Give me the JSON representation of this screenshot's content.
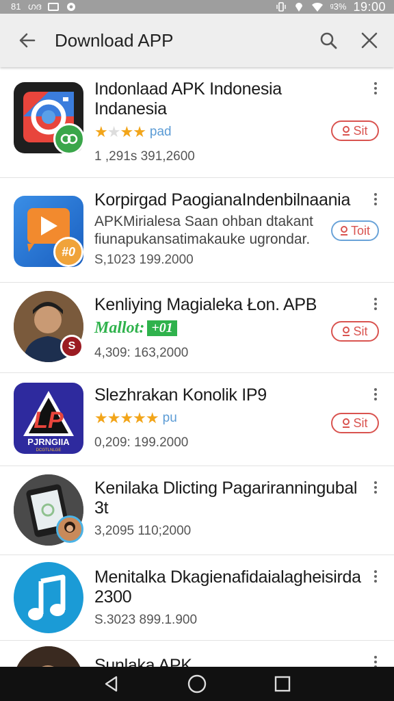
{
  "status_bar": {
    "left_text_1": "81",
    "left_text_2": "ഗദ",
    "battery_text": "ᵍ3%",
    "time": "19:00"
  },
  "appbar": {
    "title": "Download APP",
    "icons": [
      "back-arrow-icon",
      "search-icon",
      "close-icon"
    ]
  },
  "install_label": "Sit",
  "apps": [
    {
      "title": "Indonlaad APK Indonesia Indanesia",
      "rating_text": "pad",
      "stars": 4,
      "stats": "1 ,291s  391,2600",
      "install_label": "Sit",
      "icon": "camera-app-icon",
      "badge_icon": "link-badge-icon",
      "badge_color": "#3aa64a"
    },
    {
      "title": "Korpirgad PaogianaIndenbilnaania",
      "desc": "APKMirialesa Saan ohban dtakant",
      "desc2": "fiunapukansatimakauke ugrondar.",
      "stats": "S,1023  199.2000",
      "install_label": "Toit",
      "badge_text": "#0",
      "icon": "video-play-icon"
    },
    {
      "title": "Kenliying Magialeka Łon. APB",
      "promo_text": "Mallot:",
      "promo_tag": "+01",
      "stats": "4,309:  163,2000",
      "install_label": "Sit",
      "badge_text": "S",
      "icon": "person-avatar-icon"
    },
    {
      "title": "Slezhrakan Konolik IP9",
      "rating_text": "pu",
      "stars": 5,
      "stats": "0,209:  199.2000",
      "install_label": "Sit",
      "logo_text": "LP",
      "logo_sub": "PJRNGIIA",
      "logo_sub2": "DCGTLNLGE",
      "icon": "lp-logo-icon"
    },
    {
      "title": "Kenilaka Dlicting Pagariranningubal 3t",
      "stats": "3,2095  110;2000",
      "icon": "phone-app-icon"
    },
    {
      "title": "Menitalka Dkagienafidaialagheisirda 2300",
      "stats": "S.3023  899.1.900",
      "icon": "music-note-icon"
    },
    {
      "title": "Sunlaka APK",
      "icon": "person-avatar-icon"
    }
  ],
  "colors": {
    "accent_red": "#d9534f",
    "star": "#f2a51a",
    "rating_blue": "#5b9bd5",
    "promo_green": "#2fb24c",
    "statusbar": "#9e9e9e",
    "appbar": "#eeeeee",
    "navbar": "#111111"
  },
  "navbar": {
    "icons": [
      "nav-back-icon",
      "nav-home-icon",
      "nav-recents-icon"
    ]
  }
}
